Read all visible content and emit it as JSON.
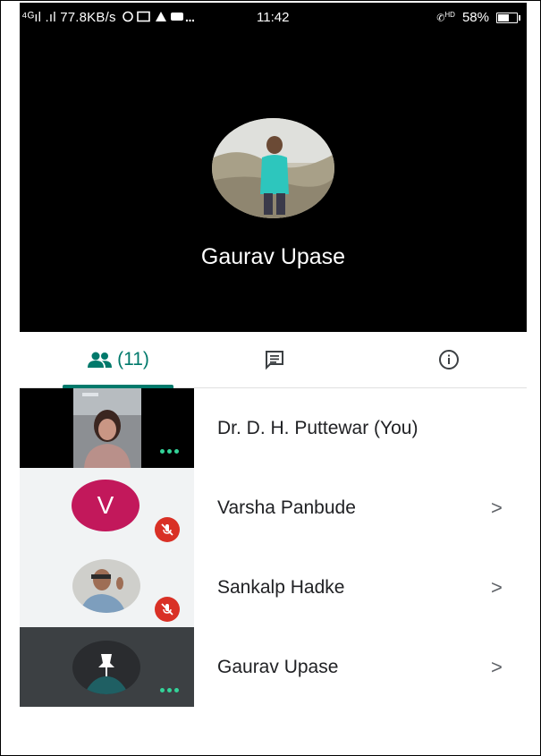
{
  "status_bar": {
    "left_text": "⁴ᴳıl .ıl 77.8KB/s",
    "time": "11:42",
    "hd_label": "HD",
    "battery": "58%"
  },
  "stage": {
    "presenter_name": "Gaurav Upase"
  },
  "tabs": {
    "people_count": "(11)"
  },
  "participants": [
    {
      "name": "Dr. D. H. Puttewar (You)"
    },
    {
      "name": "Varsha Panbude",
      "avatar_letter": "V",
      "chevron": ">"
    },
    {
      "name": "Sankalp Hadke",
      "chevron": ">"
    },
    {
      "name": "Gaurav Upase",
      "chevron": ">"
    }
  ],
  "colors": {
    "accent": "#00796b",
    "mute": "#d93025",
    "speaking_dots": "#34d399",
    "letter_avatar": "#c2185b"
  },
  "icons": [
    "people-icon",
    "chat-icon",
    "info-icon",
    "mute-icon",
    "pin-icon",
    "more-dots-icon",
    "chevron-right-icon",
    "battery-icon"
  ]
}
